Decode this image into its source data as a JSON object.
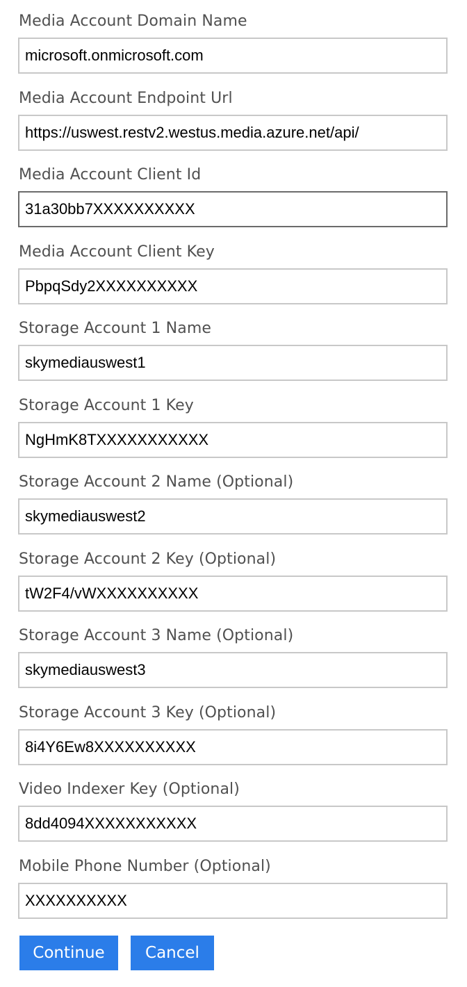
{
  "fields": [
    {
      "label": "Media Account Domain Name",
      "value": "microsoft.onmicrosoft.com"
    },
    {
      "label": "Media Account Endpoint Url",
      "value": "https://uswest.restv2.westus.media.azure.net/api/"
    },
    {
      "label": "Media Account Client Id",
      "value": "31a30bb7XXXXXXXXXX"
    },
    {
      "label": "Media Account Client Key",
      "value": "PbpqSdy2XXXXXXXXXX"
    },
    {
      "label": "Storage Account 1 Name",
      "value": "skymediauswest1"
    },
    {
      "label": "Storage Account 1 Key",
      "value": "NgHmK8TXXXXXXXXXXX"
    },
    {
      "label": "Storage Account 2 Name (Optional)",
      "value": "skymediauswest2"
    },
    {
      "label": "Storage Account 2 Key (Optional)",
      "value": "tW2F4/vWXXXXXXXXXX"
    },
    {
      "label": "Storage Account 3 Name (Optional)",
      "value": "skymediauswest3"
    },
    {
      "label": "Storage Account 3 Key (Optional)",
      "value": "8i4Y6Ew8XXXXXXXXXX"
    },
    {
      "label": "Video Indexer Key (Optional)",
      "value": "8dd4094XXXXXXXXXXX"
    },
    {
      "label": "Mobile Phone Number (Optional)",
      "value": "XXXXXXXXXX"
    }
  ],
  "actions": {
    "continue_label": "Continue",
    "cancel_label": "Cancel"
  },
  "colors": {
    "button_background": "#2b7de9",
    "button_text": "#ffffff",
    "label_text": "#505050",
    "input_border": "#c8c8c8",
    "focused_input_border": "#6b6b6b"
  }
}
